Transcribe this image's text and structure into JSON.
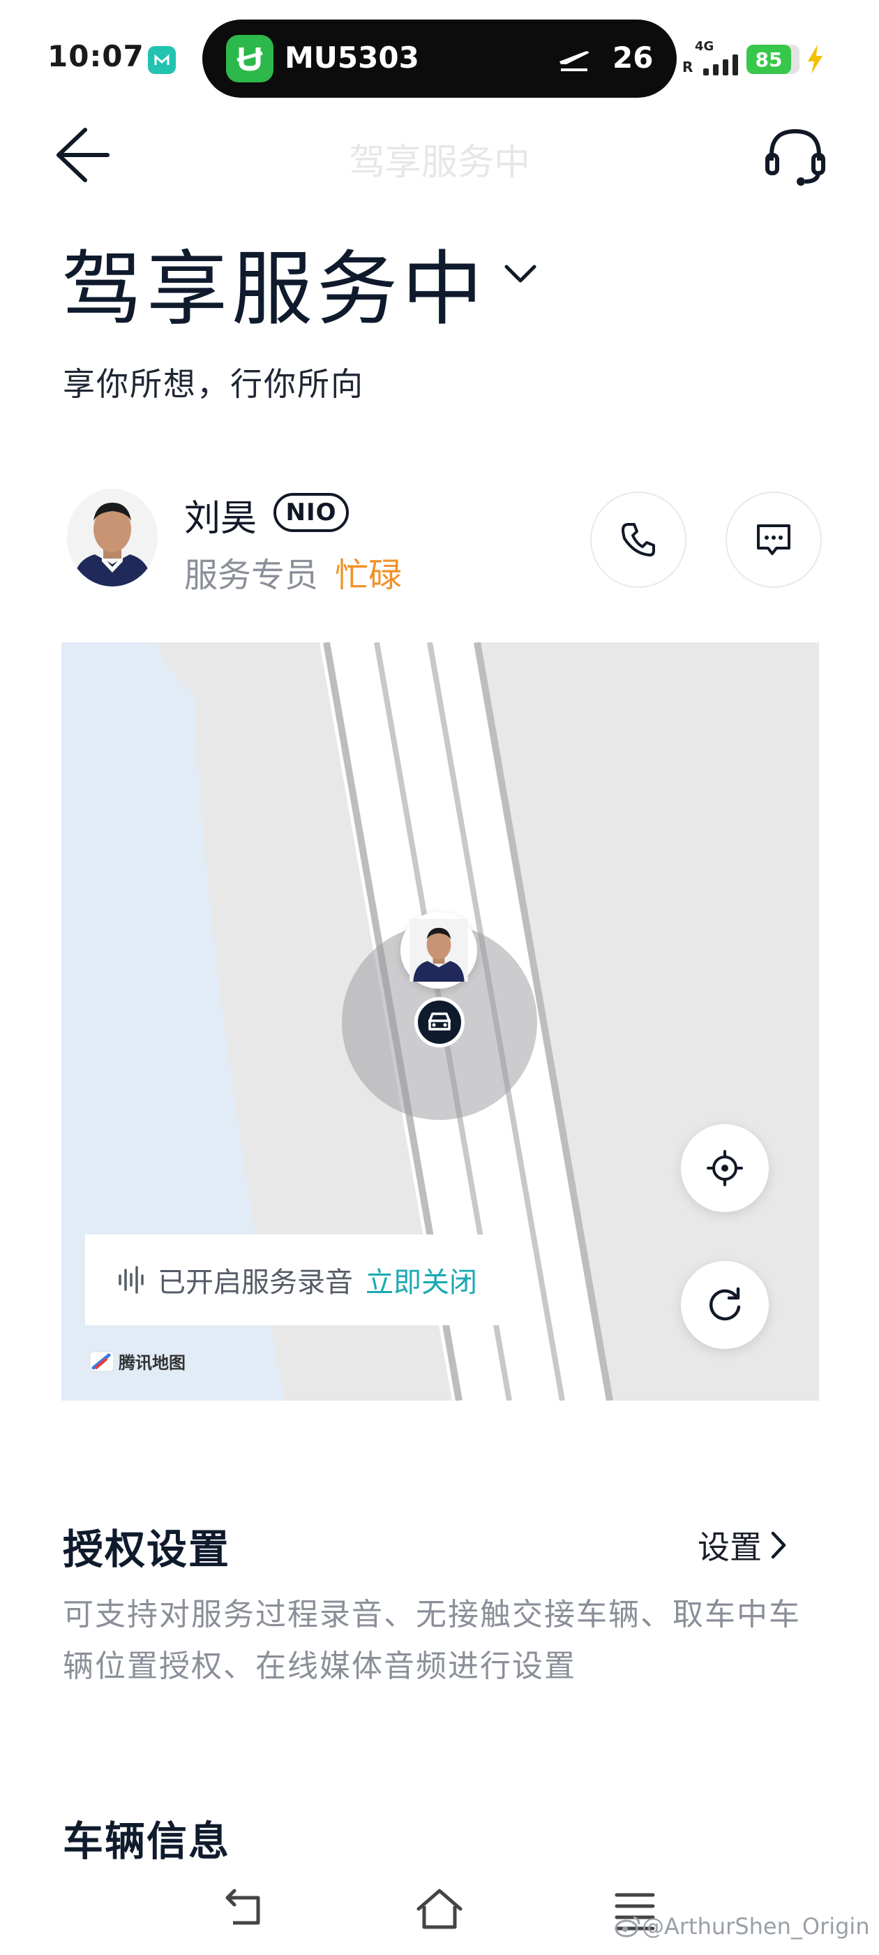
{
  "status_bar": {
    "time": "10:07",
    "flight_number": "MU5303",
    "flight_minutes": "26",
    "network": "4G",
    "roaming": "R",
    "battery": "85"
  },
  "header": {
    "nav_title": "驾享服务中",
    "title": "驾享服务中",
    "subtitle": "享你所想，行你所向"
  },
  "specialist": {
    "name": "刘昊",
    "badge": "NIO",
    "role": "服务专员",
    "status": "忙碌",
    "status_color": "#f0922a"
  },
  "map": {
    "recording_text": "已开启服务录音",
    "recording_action": "立即关闭",
    "provider": "腾讯地图",
    "accent_color": "#1aa9b3"
  },
  "auth": {
    "title": "授权设置",
    "link_label": "设置",
    "description": "可支持对服务过程录音、无接触交接车辆、取车中车辆位置授权、在线媒体音频进行设置"
  },
  "vehicle": {
    "title": "车辆信息"
  },
  "watermark": "@ArthurShen_Origin"
}
